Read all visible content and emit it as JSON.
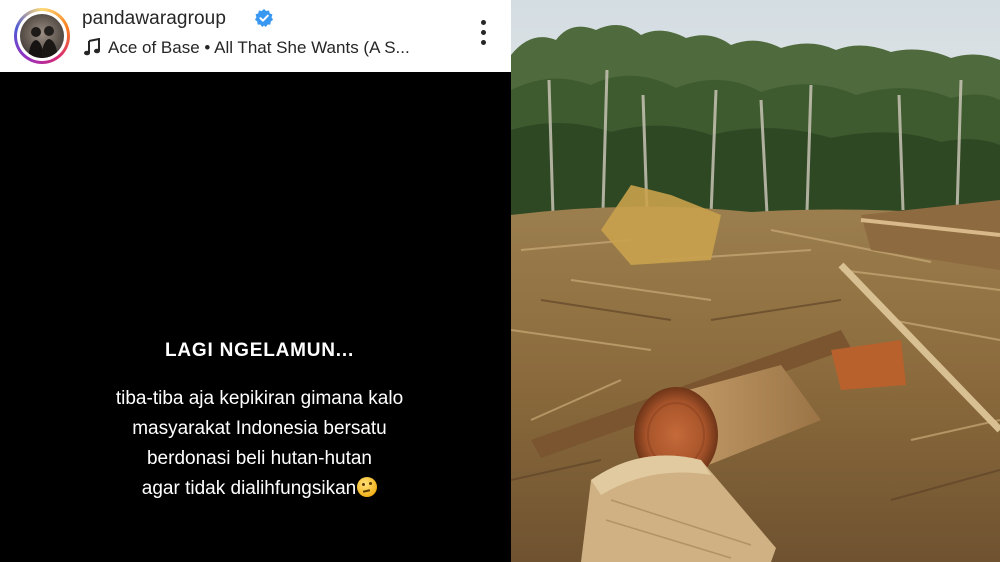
{
  "story": {
    "account": {
      "username": "pandawaragroup",
      "verified": true
    },
    "music": {
      "icon": "music-note-icon",
      "text": "Ace of Base • All That She Wants (A S..."
    },
    "menu_icon": "more-vertical-icon",
    "heading": "LAGI NGELAMUN...",
    "body_lines": [
      "tiba-tiba aja kepikiran gimana kalo",
      "masyarakat Indonesia bersatu",
      "berdonasi beli hutan-hutan",
      "agar tidak dialihfungsikan"
    ],
    "emoji": "thinking-face"
  },
  "photo": {
    "subject": "cleared forest with felled logs"
  },
  "colors": {
    "header_bg": "#ffffff",
    "story_bg": "#000000",
    "verified_blue": "#3897f0",
    "text_dark": "#262626"
  }
}
